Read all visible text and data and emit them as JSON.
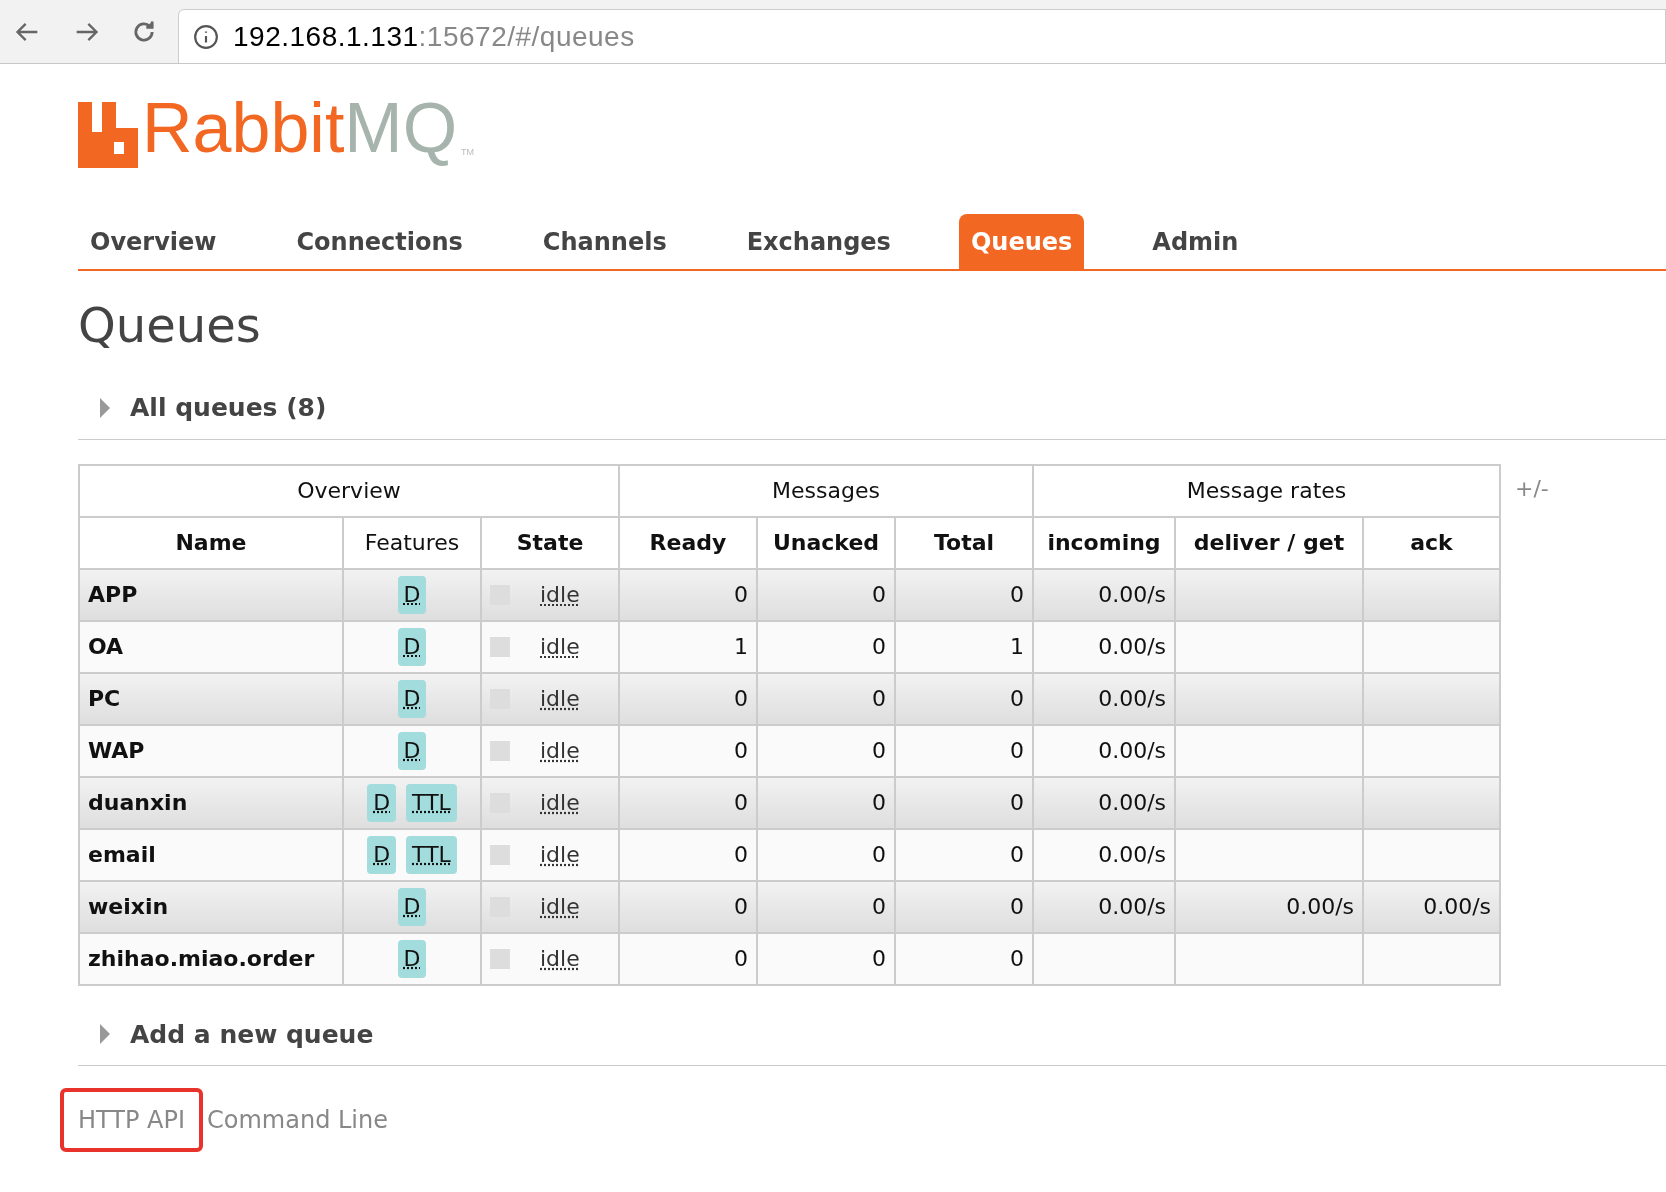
{
  "browser": {
    "address_host": "192.168.1.131",
    "address_rest": ":15672/#/queues"
  },
  "logo": {
    "word_a": "Rabbit",
    "word_b": "MQ",
    "mark": "TM"
  },
  "tabs": [
    {
      "label": "Overview",
      "selected": false
    },
    {
      "label": "Connections",
      "selected": false
    },
    {
      "label": "Channels",
      "selected": false
    },
    {
      "label": "Exchanges",
      "selected": false
    },
    {
      "label": "Queues",
      "selected": true
    },
    {
      "label": "Admin",
      "selected": false
    }
  ],
  "page_title": "Queues",
  "all_queues": {
    "label": "All queues (8)",
    "expanded": false
  },
  "table": {
    "groups": [
      {
        "label": "Overview"
      },
      {
        "label": "Messages"
      },
      {
        "label": "Message rates"
      }
    ],
    "toggle": "+/-",
    "columns": [
      {
        "label": "Name",
        "bold": true
      },
      {
        "label": "Features",
        "bold": false
      },
      {
        "label": "State",
        "bold": true
      },
      {
        "label": "Ready",
        "bold": true
      },
      {
        "label": "Unacked",
        "bold": true
      },
      {
        "label": "Total",
        "bold": true
      },
      {
        "label": "incoming",
        "bold": true
      },
      {
        "label": "deliver / get",
        "bold": true
      },
      {
        "label": "ack",
        "bold": true
      }
    ],
    "rows": [
      {
        "name": "APP",
        "features": [
          "D"
        ],
        "state": "idle",
        "ready": "0",
        "unacked": "0",
        "total": "0",
        "incoming": "0.00/s",
        "deliver": "",
        "ack": ""
      },
      {
        "name": "OA",
        "features": [
          "D"
        ],
        "state": "idle",
        "ready": "1",
        "unacked": "0",
        "total": "1",
        "incoming": "0.00/s",
        "deliver": "",
        "ack": ""
      },
      {
        "name": "PC",
        "features": [
          "D"
        ],
        "state": "idle",
        "ready": "0",
        "unacked": "0",
        "total": "0",
        "incoming": "0.00/s",
        "deliver": "",
        "ack": ""
      },
      {
        "name": "WAP",
        "features": [
          "D"
        ],
        "state": "idle",
        "ready": "0",
        "unacked": "0",
        "total": "0",
        "incoming": "0.00/s",
        "deliver": "",
        "ack": ""
      },
      {
        "name": "duanxin",
        "features": [
          "D",
          "TTL"
        ],
        "state": "idle",
        "ready": "0",
        "unacked": "0",
        "total": "0",
        "incoming": "0.00/s",
        "deliver": "",
        "ack": ""
      },
      {
        "name": "email",
        "features": [
          "D",
          "TTL"
        ],
        "state": "idle",
        "ready": "0",
        "unacked": "0",
        "total": "0",
        "incoming": "0.00/s",
        "deliver": "",
        "ack": ""
      },
      {
        "name": "weixin",
        "features": [
          "D"
        ],
        "state": "idle",
        "ready": "0",
        "unacked": "0",
        "total": "0",
        "incoming": "0.00/s",
        "deliver": "0.00/s",
        "ack": "0.00/s"
      },
      {
        "name": "zhihao.miao.order",
        "features": [
          "D"
        ],
        "state": "idle",
        "ready": "0",
        "unacked": "0",
        "total": "0",
        "incoming": "",
        "deliver": "",
        "ack": ""
      }
    ]
  },
  "add_queue": {
    "label": "Add a new queue",
    "expanded": false
  },
  "footer_links": [
    {
      "label": "HTTP API",
      "highlighted": true
    },
    {
      "label": "Command Line",
      "highlighted": false
    }
  ]
}
